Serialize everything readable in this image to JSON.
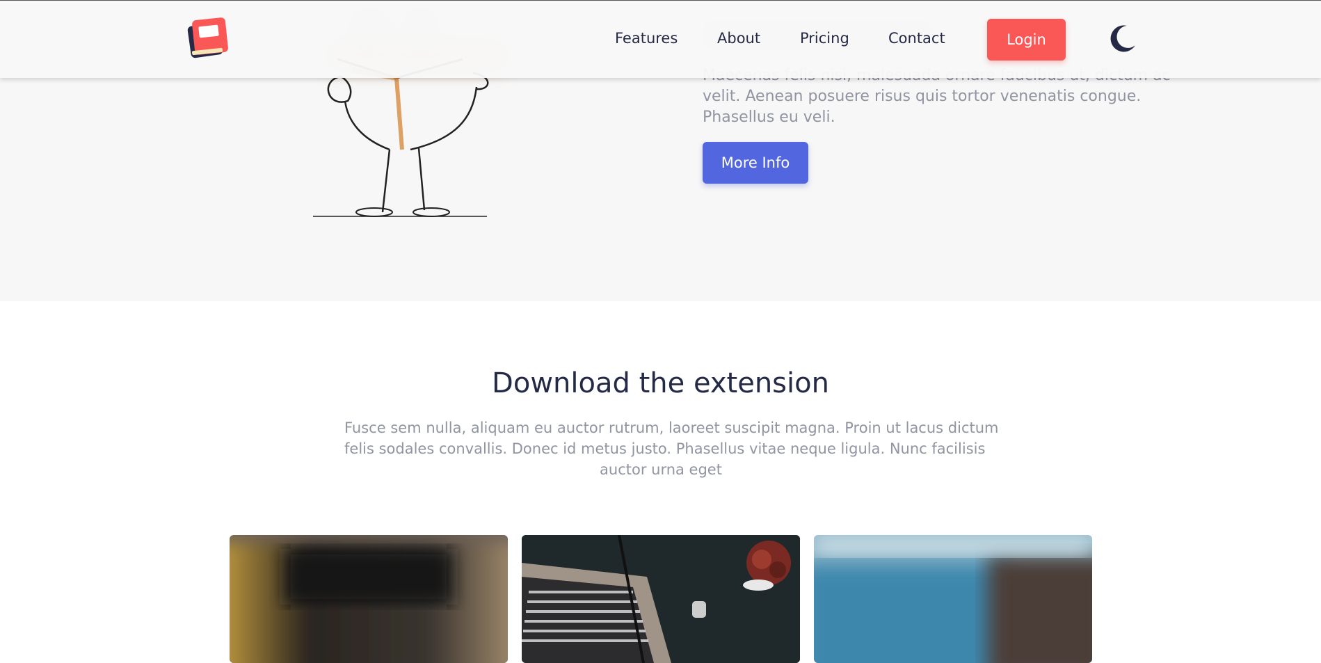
{
  "header": {
    "nav": [
      "Features",
      "About",
      "Pricing",
      "Contact"
    ],
    "login_label": "Login",
    "logo_icon": "book-logo-icon",
    "theme_icon": "moon-icon"
  },
  "hero": {
    "description_lines": [
      "Maecenas felis nisi, malesuada ornare faucibus ut, dictum ac",
      "velit. Aenean posuere risus quis tortor venenatis congue.",
      "Phasellus eu veli."
    ],
    "more_info_label": "More Info"
  },
  "download": {
    "title": "Download the extension",
    "description_lines": [
      "Fusce sem nulla, aliquam eu auctor rutrum, laoreet suscipit magna. Proin ut lacus dictum",
      "felis sodales convallis. Donec id metus justo. Phasellus vitae neque ligula. Nunc facilisis",
      "auctor urna eget"
    ]
  },
  "colors": {
    "brand_blue": "#5267df",
    "brand_red": "#fa5757",
    "text_dark": "#242a45",
    "text_muted": "#9194a1"
  }
}
